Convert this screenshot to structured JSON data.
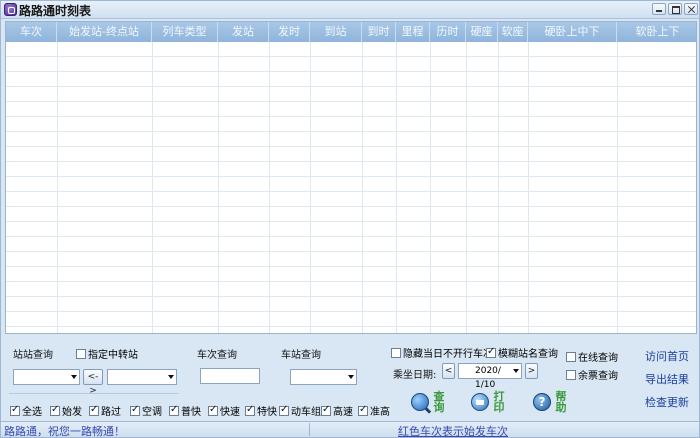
{
  "window": {
    "title": "路路通时刻表"
  },
  "table": {
    "columns": [
      {
        "label": "车次"
      },
      {
        "label": "始发站-终点站"
      },
      {
        "label": "列车类型"
      },
      {
        "label": "发站"
      },
      {
        "label": "发时"
      },
      {
        "label": "到站"
      },
      {
        "label": "到时"
      },
      {
        "label": "里程"
      },
      {
        "label": "历时"
      },
      {
        "label": "硬座"
      },
      {
        "label": "软座"
      },
      {
        "label": "硬卧上中下"
      },
      {
        "label": "软卧上下"
      }
    ]
  },
  "station_query": {
    "label": "站站查询",
    "transfer_label": "指定中转站",
    "transfer_checked": false,
    "swap_label": "<->",
    "from_value": "",
    "to_value": ""
  },
  "train_query": {
    "label": "车次查询",
    "value": ""
  },
  "stop_query": {
    "label": "车站查询",
    "value": ""
  },
  "options": {
    "hide_not_running_label": "隐藏当日不开行车次",
    "hide_not_running_checked": false,
    "fuzzy_name_label": "模糊站名查询",
    "fuzzy_name_checked": true,
    "online_query_label": "在线查询",
    "online_query_checked": false,
    "remaining_ticket_label": "余票查询",
    "remaining_ticket_checked": false
  },
  "date": {
    "label": "乘坐日期:",
    "prev": "<",
    "next": ">",
    "value": "2020/ 1/10"
  },
  "filters": [
    {
      "label": "全选",
      "checked": true
    },
    {
      "label": "始发",
      "checked": true
    },
    {
      "label": "路过",
      "checked": true
    },
    {
      "label": "空调",
      "checked": true
    },
    {
      "label": "普快",
      "checked": true
    },
    {
      "label": "快速",
      "checked": true
    },
    {
      "label": "特快",
      "checked": true
    },
    {
      "label": "动车组",
      "checked": true
    },
    {
      "label": "高速",
      "checked": true
    },
    {
      "label": "准高",
      "checked": true
    }
  ],
  "actions": {
    "query": "查询",
    "print": "打印",
    "help": "帮助",
    "help_glyph": "?"
  },
  "links": {
    "home": "访问首页",
    "export": "导出结果",
    "update": "检查更新"
  },
  "status": {
    "left": "路路通，祝您一路畅通！",
    "middle": "红色车次表示始发车次"
  }
}
